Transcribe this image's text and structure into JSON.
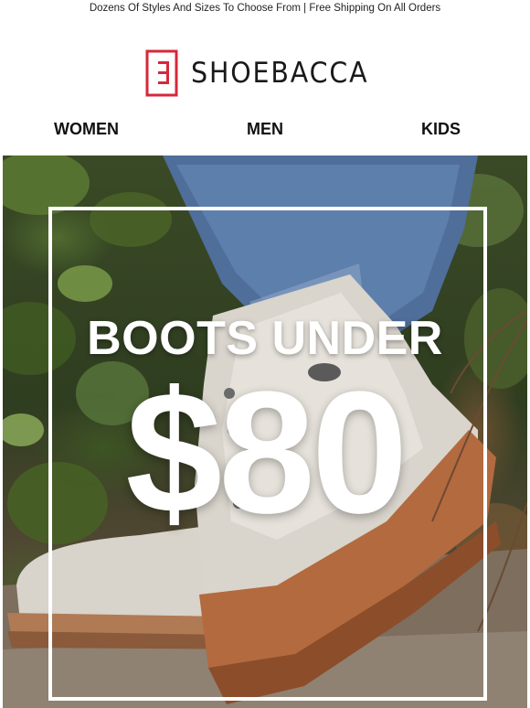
{
  "promo_bar": {
    "text": "Dozens Of Styles And Sizes To Choose From | Free Shipping On All Orders"
  },
  "brand": {
    "name": "SHOEBACCA",
    "accent_color": "#d6283a",
    "logo_icon": "shoebacca-logo-icon"
  },
  "nav": {
    "items": [
      {
        "label": "WOMEN"
      },
      {
        "label": "MEN"
      },
      {
        "label": "KIDS"
      }
    ]
  },
  "hero": {
    "line1": "BOOTS UNDER",
    "line2": "$80",
    "image": "hiking-boot-photo"
  }
}
